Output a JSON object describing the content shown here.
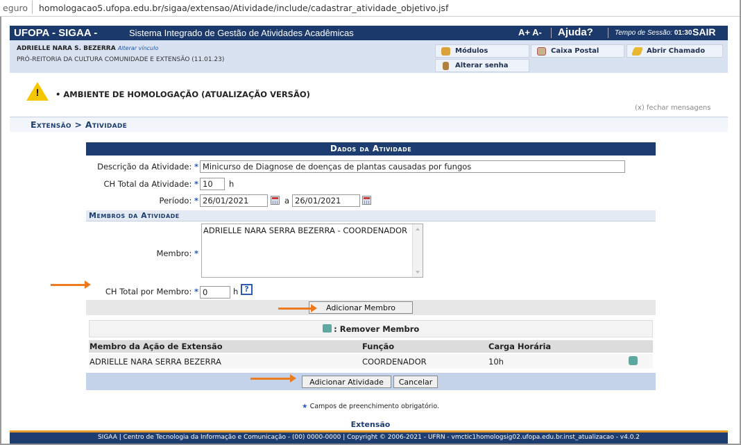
{
  "browser": {
    "scheme_fragment": "eguro",
    "url": "homologacao5.ufopa.edu.br/sigaa/extensao/Atividade/include/cadastrar_atividade_objetivo.jsf"
  },
  "topbar": {
    "brand": "UFOPA - SIGAA -",
    "system_name": "Sistema Integrado de Gestão de Atividades Acadêmicas",
    "font_size": "A+  A-",
    "help": "Ajuda?",
    "session_label": "Tempo de Sessão:",
    "session_time": "01:30",
    "exit": "SAIR"
  },
  "user": {
    "name": "ADRIELLE NARA S. BEZERRA",
    "change_link": "Alterar vínculo",
    "unit": "PRÓ-REITORIA DA CULTURA COMUNIDADE E EXTENSÃO (11.01.23)"
  },
  "quick_links": {
    "modules": "Módulos",
    "mailbox": "Caixa Postal",
    "ticket": "Abrir Chamado",
    "change_password": "Alterar senha"
  },
  "warning": {
    "icon_text": "!",
    "message": "• AMBIENTE DE HOMOLOGAÇÃO (ATUALIZAÇÃO VERSÃO)",
    "close": "(x) fechar mensagens"
  },
  "breadcrumb": "Extensão > Atividade",
  "form": {
    "title": "Dados da Atividade",
    "description_label": "Descrição da Atividade:",
    "description_value": "Minicurso de Diagnose de doenças de plantas causadas por fungos",
    "ch_total_label": "CH Total da Atividade:",
    "ch_total_value": "10",
    "hours_unit": "h",
    "period_label": "Período:",
    "period_start": "26/01/2021",
    "period_sep": "a",
    "period_end": "26/01/2021",
    "members_section": "Membros da Atividade",
    "member_label": "Membro:",
    "member_option": "ADRIELLE NARA SERRA BEZERRA - COORDENADOR",
    "ch_member_label": "CH Total por Membro:",
    "ch_member_value": "0",
    "help_icon": "?",
    "add_member": "Adicionar Membro",
    "remove_legend": ": Remover Membro",
    "columns": [
      "Membro da Ação de Extensão",
      "Função",
      "Carga Horária"
    ],
    "rows": [
      {
        "member": "ADRIELLE NARA SERRA BEZERRA",
        "role": "COORDENADOR",
        "hours": "10h"
      }
    ],
    "add_activity": "Adicionar Atividade",
    "cancel": "Cancelar"
  },
  "footer": {
    "required_note": "Campos de preenchimento obrigatório.",
    "star": "★",
    "link": "Extensão",
    "bar": "SIGAA | Centro de Tecnologia da Informação e Comunicação - (00) 0000-0000 | Copyright © 2006-2021 - UFRN - vmctic1homologsig02.ufopa.edu.br.inst_atualizacao - v4.0.2"
  },
  "colors": {
    "header": "#1b3a6b",
    "accent_arrow": "#ee7a1e",
    "required_star": "#2b5bb5",
    "warning": "#f5c700"
  }
}
